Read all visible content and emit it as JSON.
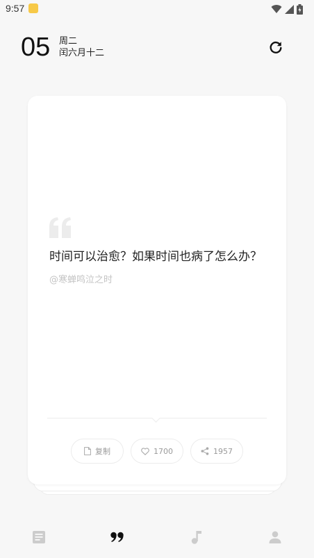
{
  "status_bar": {
    "time": "9:57"
  },
  "header": {
    "day": "05",
    "weekday": "周二",
    "lunar_date": "闰六月十二"
  },
  "card": {
    "quote": "时间可以治愈？如果时间也病了怎么办？",
    "author": "@寒蝉鸣泣之时",
    "actions": {
      "copy_label": "复制",
      "like_count": "1700",
      "share_count": "1957"
    }
  },
  "icons": {
    "refresh": "refresh-icon",
    "quote_mark": "open-quote-icon",
    "copy": "document-icon",
    "like": "heart-icon",
    "share": "share-icon",
    "nav": [
      "article-icon",
      "quote-icon",
      "music-note-icon",
      "person-icon"
    ]
  },
  "colors": {
    "background": "#f7f7f7",
    "card": "#ffffff",
    "muted_text": "#c4c4c4",
    "nav_active": "#111111",
    "nav_inactive": "#cccccc"
  }
}
